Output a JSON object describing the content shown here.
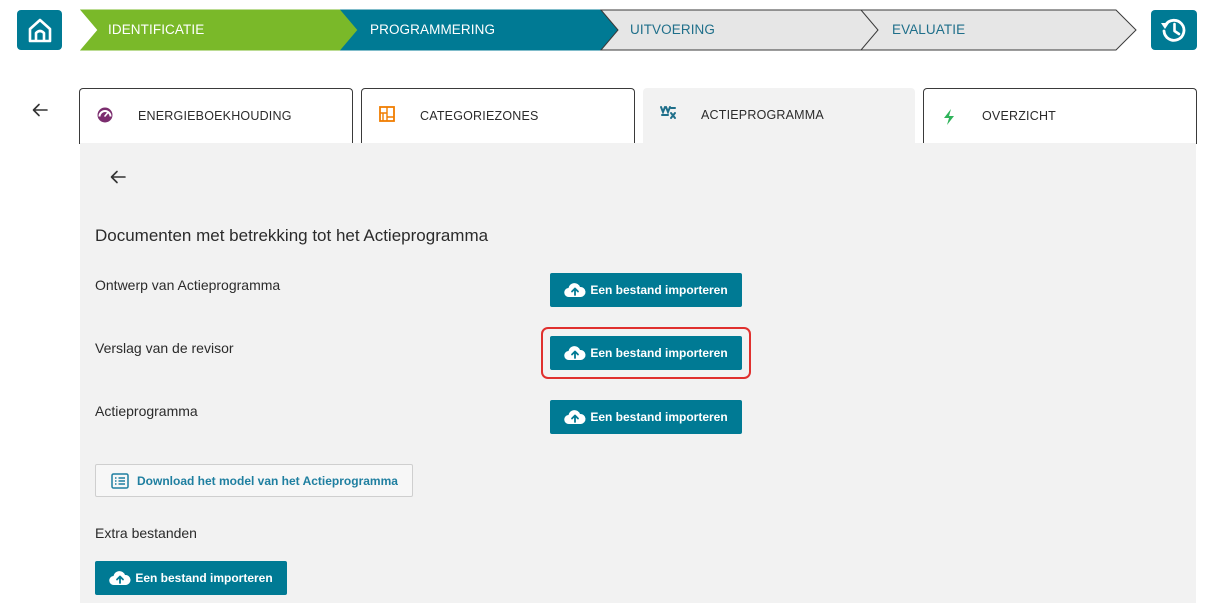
{
  "topbar": {
    "steps": [
      {
        "label": "IDENTIFICATIE",
        "state": "done"
      },
      {
        "label": "PROGRAMMERING",
        "state": "current"
      },
      {
        "label": "UITVOERING",
        "state": "upcoming"
      },
      {
        "label": "EVALUATIE",
        "state": "upcoming"
      }
    ],
    "home_icon": "home-icon",
    "history_icon": "history-icon"
  },
  "tabs": [
    {
      "label": "ENERGIEBOEKHOUDING",
      "icon": "gauge-icon"
    },
    {
      "label": "CATEGORIEZONES",
      "icon": "map-icon",
      "icon_color": "#f07d00"
    },
    {
      "label": "ACTIEPROGRAMMA",
      "icon": "actions-icon",
      "active": true
    },
    {
      "label": "OVERZICHT",
      "icon": "bolt-icon",
      "icon_color": "#2fb35a"
    }
  ],
  "main": {
    "title": "Documenten met betrekking tot het Actieprogramma",
    "rows": [
      {
        "label": "Ontwerp van Actieprogramma",
        "button": "Een bestand importeren"
      },
      {
        "label": "Verslag van de revisor",
        "button": "Een bestand importeren",
        "highlighted": true
      },
      {
        "label": "Actieprogramma",
        "button": "Een bestand importeren"
      }
    ],
    "download_label": "Download het model van het Actieprogramma",
    "extra_label": "Extra bestanden",
    "extra_button": "Een bestand importeren"
  },
  "colors": {
    "accent": "#007a94",
    "done_step": "#7ab929",
    "highlight": "#e0302e",
    "panel_bg": "#f2f2f2"
  }
}
